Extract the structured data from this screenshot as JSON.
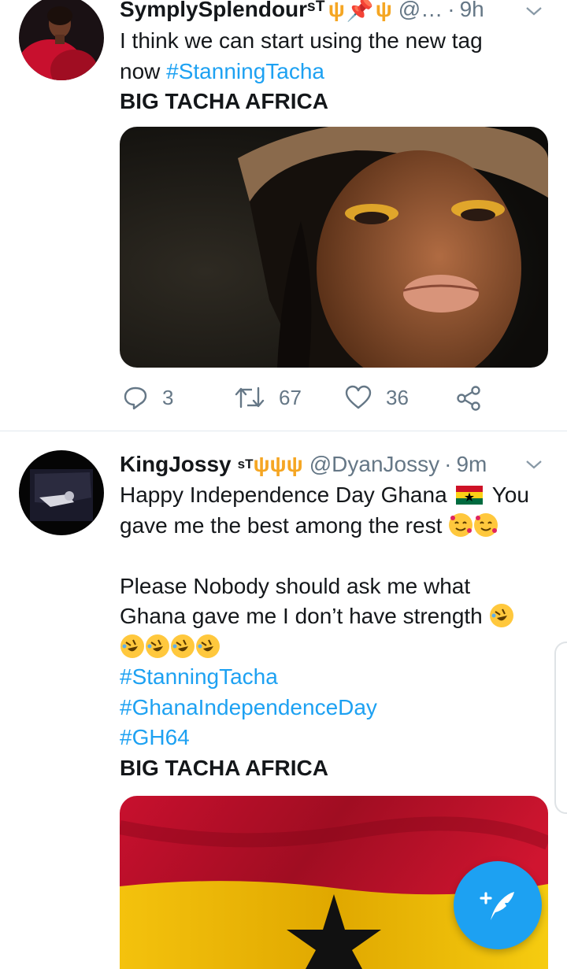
{
  "tweet1": {
    "display_name": "SymplySplendourˢᵀ",
    "handle": "@…",
    "separator": "·",
    "time": "9h",
    "text_line1": "I think we can start using the new tag",
    "text_line2_prefix": "now",
    "hashtag": "#StanningTacha",
    "bold_line": "BIG TACHA AFRICA",
    "replies": "3",
    "retweets": "67",
    "likes": "36"
  },
  "tweet2": {
    "display_name": "KingJossy",
    "superscript": "sT",
    "handle": "@DyanJossy",
    "separator": "·",
    "time": "9m",
    "line1": "Happy Independence Day Ghana",
    "line1_suffix": "You",
    "line2": "gave me the best among the rest",
    "line4": "Please Nobody should ask me what",
    "line5": "Ghana gave me I don’t have strength",
    "hashtags": [
      "#StanningTacha",
      "#GhanaIndependenceDay",
      "#GH64"
    ],
    "bold_line": "BIG TACHA AFRICA"
  },
  "icons": {
    "reply": "reply-icon",
    "retweet": "retweet-icon",
    "like": "heart-icon",
    "share": "share-icon",
    "compose": "compose-tweet-icon"
  },
  "colors": {
    "accent": "#1da1f2",
    "secondary_text": "#657786",
    "divider": "#e1e8ed"
  }
}
